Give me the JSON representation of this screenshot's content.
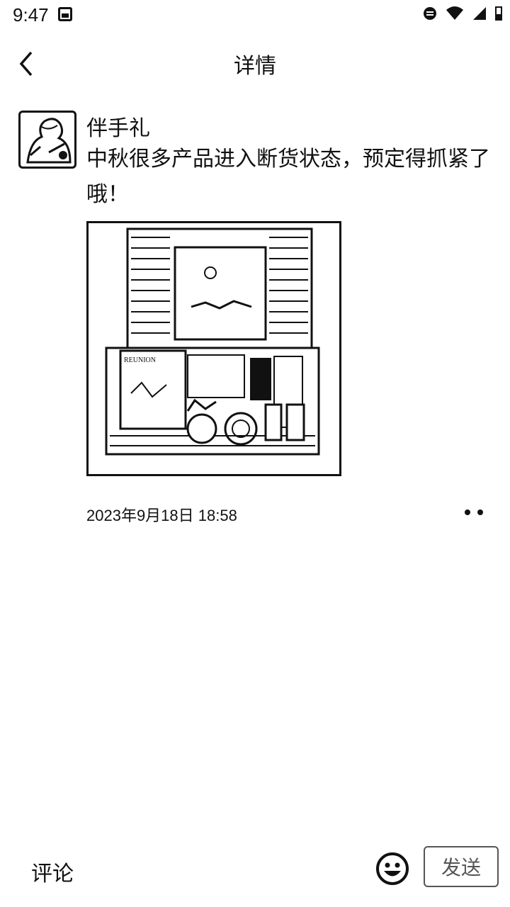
{
  "status_bar": {
    "time": "9:47"
  },
  "header": {
    "title": "详情"
  },
  "post": {
    "author": "伴手礼",
    "text": "中秋很多产品进入断货状态，预定得抓紧了哦！",
    "timestamp": "2023年9月18日 18:58",
    "image_label_1": "REUNION"
  },
  "footer": {
    "comment_label": "评论",
    "send_label": "发送"
  },
  "icons": {
    "back": "back-chevron-icon",
    "more": "more-dots-icon",
    "emoji": "emoji-smile-icon"
  }
}
